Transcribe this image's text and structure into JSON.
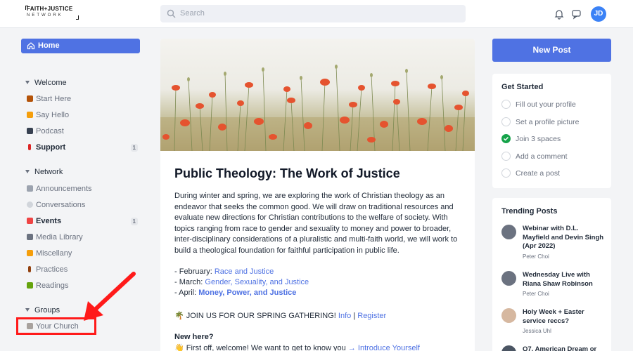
{
  "logo": {
    "line1": "FAITH+JUSTICE",
    "line2": "NETWORK"
  },
  "search": {
    "placeholder": "Search",
    "icon": "search-icon"
  },
  "user": {
    "initials": "JD"
  },
  "sidebar": {
    "home_label": "Home",
    "sections": [
      {
        "title": "Welcome",
        "items": [
          {
            "label": "Start Here",
            "emoji_color": "#b45309",
            "count": ""
          },
          {
            "label": "Say Hello",
            "emoji_color": "#f59e0b",
            "count": ""
          },
          {
            "label": "Podcast",
            "emoji_color": "#374151",
            "count": ""
          },
          {
            "label": "Support",
            "emoji_color": "#dc2626",
            "count": "1"
          }
        ]
      },
      {
        "title": "Network",
        "items": [
          {
            "label": "Announcements",
            "emoji_color": "#9ca3af",
            "count": ""
          },
          {
            "label": "Conversations",
            "emoji_color": "#d1d5db",
            "count": ""
          },
          {
            "label": "Events",
            "emoji_color": "#ef4444",
            "count": "1"
          },
          {
            "label": "Media Library",
            "emoji_color": "#6b7280",
            "count": ""
          },
          {
            "label": "Miscellany",
            "emoji_color": "#f59e0b",
            "count": ""
          },
          {
            "label": "Practices",
            "emoji_color": "#92400e",
            "count": ""
          },
          {
            "label": "Readings",
            "emoji_color": "#65a30d",
            "count": ""
          }
        ]
      },
      {
        "title": "Groups",
        "items": [
          {
            "label": "Your Church",
            "emoji_color": "#a8a29e",
            "count": ""
          }
        ]
      }
    ]
  },
  "post": {
    "title": "Public Theology: The Work of Justice",
    "body": "During winter and spring, we are exploring the work of Christian theology as an endeavor that seeks the common good. We will draw on traditional resources and evaluate new directions for Christian contributions to the welfare of society. With topics ranging from race to gender and sexuality to money and power to broader, inter-disciplinary considerations of a pluralistic and multi-faith world, we will work to build a theological foundation for faithful participation in public life.",
    "schedule": [
      {
        "prefix": "- February: ",
        "link": "Race and Justice"
      },
      {
        "prefix": "- March: ",
        "link": "Gender, Sexuality, and Justice"
      },
      {
        "prefix": "- April: ",
        "link": "Money, Power, and Justice"
      }
    ],
    "gathering_text": "🌴 JOIN US FOR OUR SPRING GATHERING! ",
    "gathering_info": "Info",
    "gathering_sep": " | ",
    "gathering_register": "Register",
    "new_here": "New here?",
    "welcome_text": "👋 First off, welcome! We want to get to know you ",
    "welcome_link": "→ Introduce Yourself"
  },
  "right": {
    "new_post_label": "New Post",
    "get_started": {
      "title": "Get Started",
      "items": [
        {
          "label": "Fill out your profile",
          "done": false
        },
        {
          "label": "Set a profile picture",
          "done": false
        },
        {
          "label": "Join 3 spaces",
          "done": true
        },
        {
          "label": "Add a comment",
          "done": false
        },
        {
          "label": "Create a post",
          "done": false
        }
      ]
    },
    "trending": {
      "title": "Trending Posts",
      "items": [
        {
          "title": "Webinar with D.L. Mayfield and Devin Singh (Apr 2022)",
          "author": "Peter Choi",
          "avatar_color": "#6b7280"
        },
        {
          "title": "Wednesday Live with Riana Shaw Robinson",
          "author": "Peter Choi",
          "avatar_color": "#6b7280"
        },
        {
          "title": "Holy Week + Easter service reccs?",
          "author": "Jessica Uhl",
          "avatar_color": "#d6b8a0"
        },
        {
          "title": "Q7. American Dream or",
          "author": "",
          "avatar_color": "#4b5563"
        }
      ]
    }
  },
  "colors": {
    "accent": "#4f72e3",
    "annotation": "#ff1a1a",
    "check": "#16a34a"
  }
}
